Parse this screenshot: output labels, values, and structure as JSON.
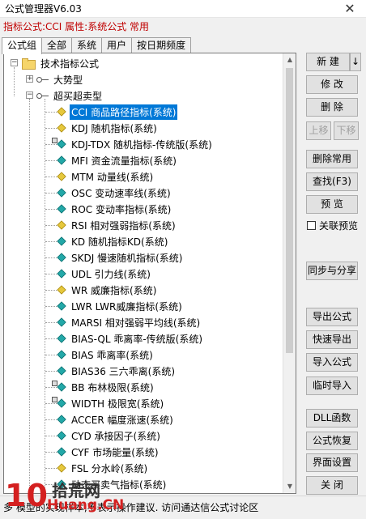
{
  "window": {
    "title": "公式管理器V6.03",
    "close": "✕"
  },
  "subtitle": "指标公式:CCI 属性:系统公式 常用",
  "tabs": [
    "公式组",
    "全部",
    "系统",
    "用户",
    "按日期频度"
  ],
  "tree": {
    "root": "技术指标公式",
    "groups": [
      "大势型",
      "超买超卖型"
    ],
    "items": [
      {
        "label": "CCI  商品路径指标(系统)",
        "icon": "yellow",
        "selected": true
      },
      {
        "label": "KDJ  随机指标(系统)",
        "icon": "yellow"
      },
      {
        "label": "KDJ-TDX  随机指标-传统版(系统)",
        "icon": "teal",
        "lock": true
      },
      {
        "label": "MFI  资金流量指标(系统)",
        "icon": "teal"
      },
      {
        "label": "MTM  动量线(系统)",
        "icon": "yellow"
      },
      {
        "label": "OSC  变动速率线(系统)",
        "icon": "teal"
      },
      {
        "label": "ROC  变动率指标(系统)",
        "icon": "teal"
      },
      {
        "label": "RSI  相对强弱指标(系统)",
        "icon": "yellow"
      },
      {
        "label": "KD  随机指标KD(系统)",
        "icon": "teal"
      },
      {
        "label": "SKDJ  慢速随机指标(系统)",
        "icon": "teal"
      },
      {
        "label": "UDL  引力线(系统)",
        "icon": "teal"
      },
      {
        "label": "WR  威廉指标(系统)",
        "icon": "yellow"
      },
      {
        "label": "LWR  LWR威廉指标(系统)",
        "icon": "teal"
      },
      {
        "label": "MARSI  相对强弱平均线(系统)",
        "icon": "teal"
      },
      {
        "label": "BIAS-QL  乖离率-传统版(系统)",
        "icon": "teal"
      },
      {
        "label": "BIAS  乖离率(系统)",
        "icon": "teal"
      },
      {
        "label": "BIAS36  三六乖离(系统)",
        "icon": "teal"
      },
      {
        "label": "BB  布林极限(系统)",
        "icon": "teal",
        "lock": true
      },
      {
        "label": "WIDTH  极限宽(系统)",
        "icon": "teal",
        "lock": true
      },
      {
        "label": "ACCER  幅度涨速(系统)",
        "icon": "teal"
      },
      {
        "label": "CYD  承接因子(系统)",
        "icon": "teal"
      },
      {
        "label": "CYF  市场能量(系统)",
        "icon": "teal"
      },
      {
        "label": "FSL  分水岭(系统)",
        "icon": "yellow"
      },
      {
        "label": "动态买卖气指标(系统)",
        "icon": "teal"
      }
    ]
  },
  "buttons": {
    "new": "新 建",
    "new_arrow": "↓",
    "edit": "修 改",
    "delete": "删 除",
    "move_up": "上移",
    "move_down": "下移",
    "delete_common": "删除常用",
    "find": "查找(F3)",
    "preview": "预 览",
    "link_preview": "关联预览",
    "sync_share": "同步与分享",
    "export": "导出公式",
    "quick_export": "快速导出",
    "import": "导入公式",
    "temp_import": "临时导入",
    "dll": "DLL函数",
    "restore": "公式恢复",
    "ui_settings": "界面设置",
    "close": "关 闭"
  },
  "status": "多       模型的实现样本,不表示操作建议.   访问通达信公式讨论区",
  "watermark": {
    "logo": "10",
    "top": "拾荒网",
    "bottom": "Huang.CN"
  }
}
